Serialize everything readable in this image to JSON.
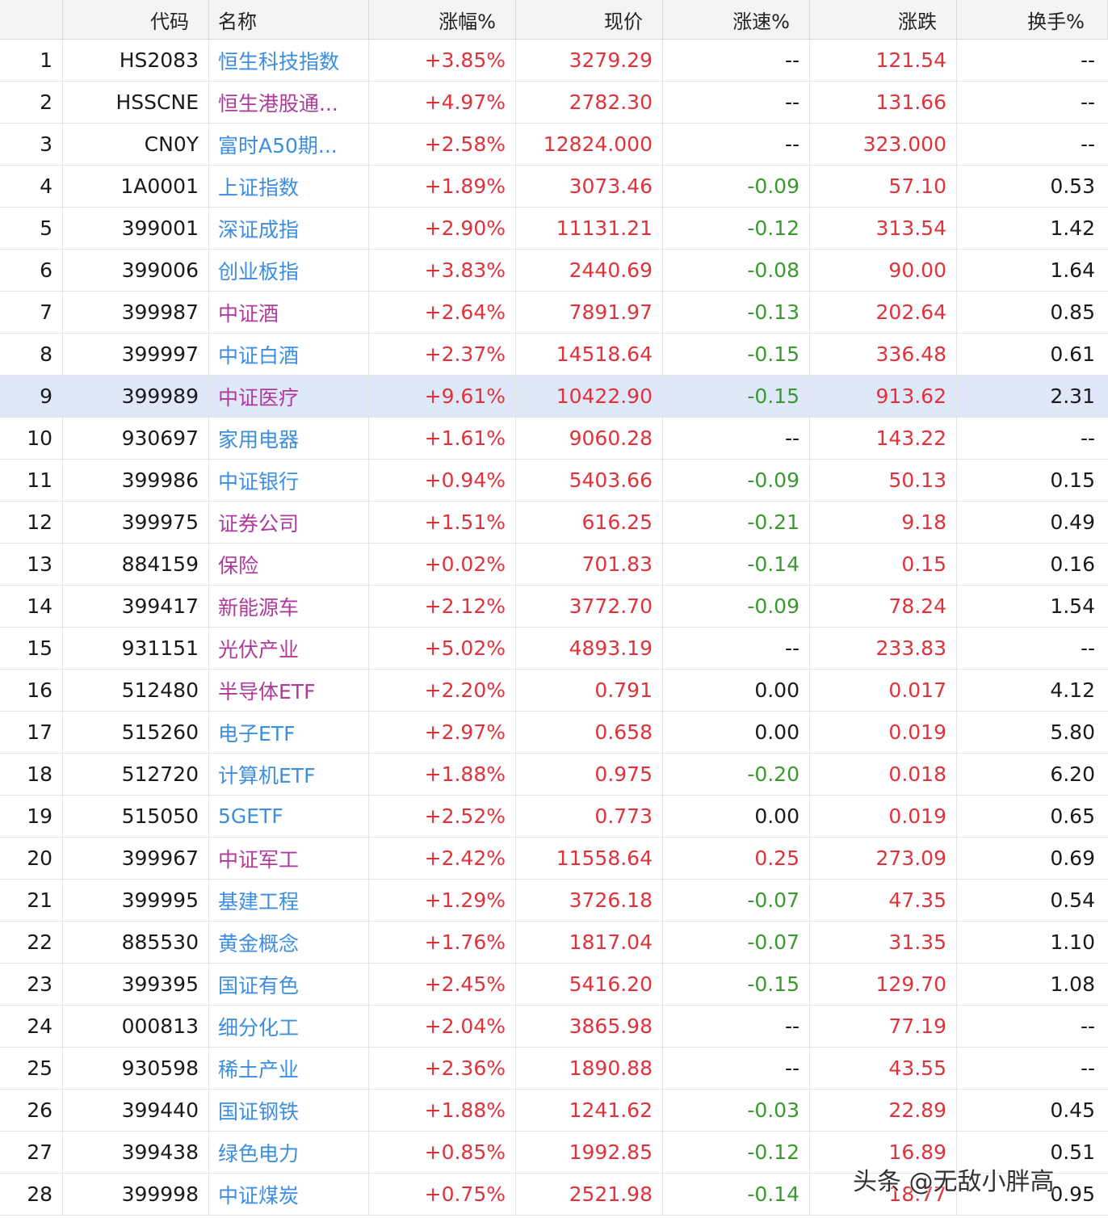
{
  "colors": {
    "up": "#e0323a",
    "down": "#3a9a2f",
    "name_blue": "#3c8ee0",
    "name_purple": "#b03a9c",
    "selected_row": "#dfe8f8",
    "header_bg": "#f4f4f4"
  },
  "table": {
    "headers": {
      "index": "",
      "code": "代码",
      "name": "名称",
      "change_pct": "涨幅%",
      "price": "现价",
      "speed_pct": "涨速%",
      "change": "涨跌",
      "turnover_pct": "换手%"
    },
    "selected_row": 9,
    "rows": [
      {
        "index": "1",
        "code": "HS2083",
        "name": "恒生科技指数",
        "name_color": "blue",
        "change_pct": "+3.85%",
        "price": "3279.29",
        "speed_pct": "--",
        "change": "121.54",
        "turnover_pct": "--"
      },
      {
        "index": "2",
        "code": "HSSCNE",
        "name": "恒生港股通...",
        "name_color": "purple",
        "change_pct": "+4.97%",
        "price": "2782.30",
        "speed_pct": "--",
        "change": "131.66",
        "turnover_pct": "--"
      },
      {
        "index": "3",
        "code": "CN0Y",
        "name": "富时A50期...",
        "name_color": "blue",
        "change_pct": "+2.58%",
        "price": "12824.000",
        "speed_pct": "--",
        "change": "323.000",
        "turnover_pct": "--"
      },
      {
        "index": "4",
        "code": "1A0001",
        "name": "上证指数",
        "name_color": "blue",
        "change_pct": "+1.89%",
        "price": "3073.46",
        "speed_pct": "-0.09",
        "change": "57.10",
        "turnover_pct": "0.53"
      },
      {
        "index": "5",
        "code": "399001",
        "name": "深证成指",
        "name_color": "blue",
        "change_pct": "+2.90%",
        "price": "11131.21",
        "speed_pct": "-0.12",
        "change": "313.54",
        "turnover_pct": "1.42"
      },
      {
        "index": "6",
        "code": "399006",
        "name": "创业板指",
        "name_color": "blue",
        "change_pct": "+3.83%",
        "price": "2440.69",
        "speed_pct": "-0.08",
        "change": "90.00",
        "turnover_pct": "1.64"
      },
      {
        "index": "7",
        "code": "399987",
        "name": "中证酒",
        "name_color": "purple",
        "change_pct": "+2.64%",
        "price": "7891.97",
        "speed_pct": "-0.13",
        "change": "202.64",
        "turnover_pct": "0.85"
      },
      {
        "index": "8",
        "code": "399997",
        "name": "中证白酒",
        "name_color": "blue",
        "change_pct": "+2.37%",
        "price": "14518.64",
        "speed_pct": "-0.15",
        "change": "336.48",
        "turnover_pct": "0.61"
      },
      {
        "index": "9",
        "code": "399989",
        "name": "中证医疗",
        "name_color": "purple",
        "change_pct": "+9.61%",
        "price": "10422.90",
        "speed_pct": "-0.15",
        "change": "913.62",
        "turnover_pct": "2.31"
      },
      {
        "index": "10",
        "code": "930697",
        "name": "家用电器",
        "name_color": "blue",
        "change_pct": "+1.61%",
        "price": "9060.28",
        "speed_pct": "--",
        "change": "143.22",
        "turnover_pct": "--"
      },
      {
        "index": "11",
        "code": "399986",
        "name": "中证银行",
        "name_color": "blue",
        "change_pct": "+0.94%",
        "price": "5403.66",
        "speed_pct": "-0.09",
        "change": "50.13",
        "turnover_pct": "0.15"
      },
      {
        "index": "12",
        "code": "399975",
        "name": "证券公司",
        "name_color": "purple",
        "change_pct": "+1.51%",
        "price": "616.25",
        "speed_pct": "-0.21",
        "change": "9.18",
        "turnover_pct": "0.49"
      },
      {
        "index": "13",
        "code": "884159",
        "name": "保险",
        "name_color": "purple",
        "change_pct": "+0.02%",
        "price": "701.83",
        "speed_pct": "-0.14",
        "change": "0.15",
        "turnover_pct": "0.16"
      },
      {
        "index": "14",
        "code": "399417",
        "name": "新能源车",
        "name_color": "purple",
        "change_pct": "+2.12%",
        "price": "3772.70",
        "speed_pct": "-0.09",
        "change": "78.24",
        "turnover_pct": "1.54"
      },
      {
        "index": "15",
        "code": "931151",
        "name": "光伏产业",
        "name_color": "purple",
        "change_pct": "+5.02%",
        "price": "4893.19",
        "speed_pct": "--",
        "change": "233.83",
        "turnover_pct": "--"
      },
      {
        "index": "16",
        "code": "512480",
        "name": "半导体ETF",
        "name_color": "purple",
        "change_pct": "+2.20%",
        "price": "0.791",
        "speed_pct": "0.00",
        "change": "0.017",
        "turnover_pct": "4.12"
      },
      {
        "index": "17",
        "code": "515260",
        "name": "电子ETF",
        "name_color": "blue",
        "change_pct": "+2.97%",
        "price": "0.658",
        "speed_pct": "0.00",
        "change": "0.019",
        "turnover_pct": "5.80"
      },
      {
        "index": "18",
        "code": "512720",
        "name": "计算机ETF",
        "name_color": "blue",
        "change_pct": "+1.88%",
        "price": "0.975",
        "speed_pct": "-0.20",
        "change": "0.018",
        "turnover_pct": "6.20"
      },
      {
        "index": "19",
        "code": "515050",
        "name": "5GETF",
        "name_color": "blue",
        "change_pct": "+2.52%",
        "price": "0.773",
        "speed_pct": "0.00",
        "change": "0.019",
        "turnover_pct": "0.65"
      },
      {
        "index": "20",
        "code": "399967",
        "name": "中证军工",
        "name_color": "purple",
        "change_pct": "+2.42%",
        "price": "11558.64",
        "speed_pct": "0.25",
        "change": "273.09",
        "turnover_pct": "0.69"
      },
      {
        "index": "21",
        "code": "399995",
        "name": "基建工程",
        "name_color": "blue",
        "change_pct": "+1.29%",
        "price": "3726.18",
        "speed_pct": "-0.07",
        "change": "47.35",
        "turnover_pct": "0.54"
      },
      {
        "index": "22",
        "code": "885530",
        "name": "黄金概念",
        "name_color": "blue",
        "change_pct": "+1.76%",
        "price": "1817.04",
        "speed_pct": "-0.07",
        "change": "31.35",
        "turnover_pct": "1.10"
      },
      {
        "index": "23",
        "code": "399395",
        "name": "国证有色",
        "name_color": "blue",
        "change_pct": "+2.45%",
        "price": "5416.20",
        "speed_pct": "-0.15",
        "change": "129.70",
        "turnover_pct": "1.08"
      },
      {
        "index": "24",
        "code": "000813",
        "name": "细分化工",
        "name_color": "blue",
        "change_pct": "+2.04%",
        "price": "3865.98",
        "speed_pct": "--",
        "change": "77.19",
        "turnover_pct": "--"
      },
      {
        "index": "25",
        "code": "930598",
        "name": "稀土产业",
        "name_color": "blue",
        "change_pct": "+2.36%",
        "price": "1890.88",
        "speed_pct": "--",
        "change": "43.55",
        "turnover_pct": "--"
      },
      {
        "index": "26",
        "code": "399440",
        "name": "国证钢铁",
        "name_color": "blue",
        "change_pct": "+1.88%",
        "price": "1241.62",
        "speed_pct": "-0.03",
        "change": "22.89",
        "turnover_pct": "0.45"
      },
      {
        "index": "27",
        "code": "399438",
        "name": "绿色电力",
        "name_color": "blue",
        "change_pct": "+0.85%",
        "price": "1992.85",
        "speed_pct": "-0.12",
        "change": "16.89",
        "turnover_pct": "0.51"
      },
      {
        "index": "28",
        "code": "399998",
        "name": "中证煤炭",
        "name_color": "blue",
        "change_pct": "+0.75%",
        "price": "2521.98",
        "speed_pct": "-0.14",
        "change": "18.77",
        "turnover_pct": "0.95"
      }
    ]
  },
  "watermark": {
    "text": "头条 @无敌小胖高"
  }
}
